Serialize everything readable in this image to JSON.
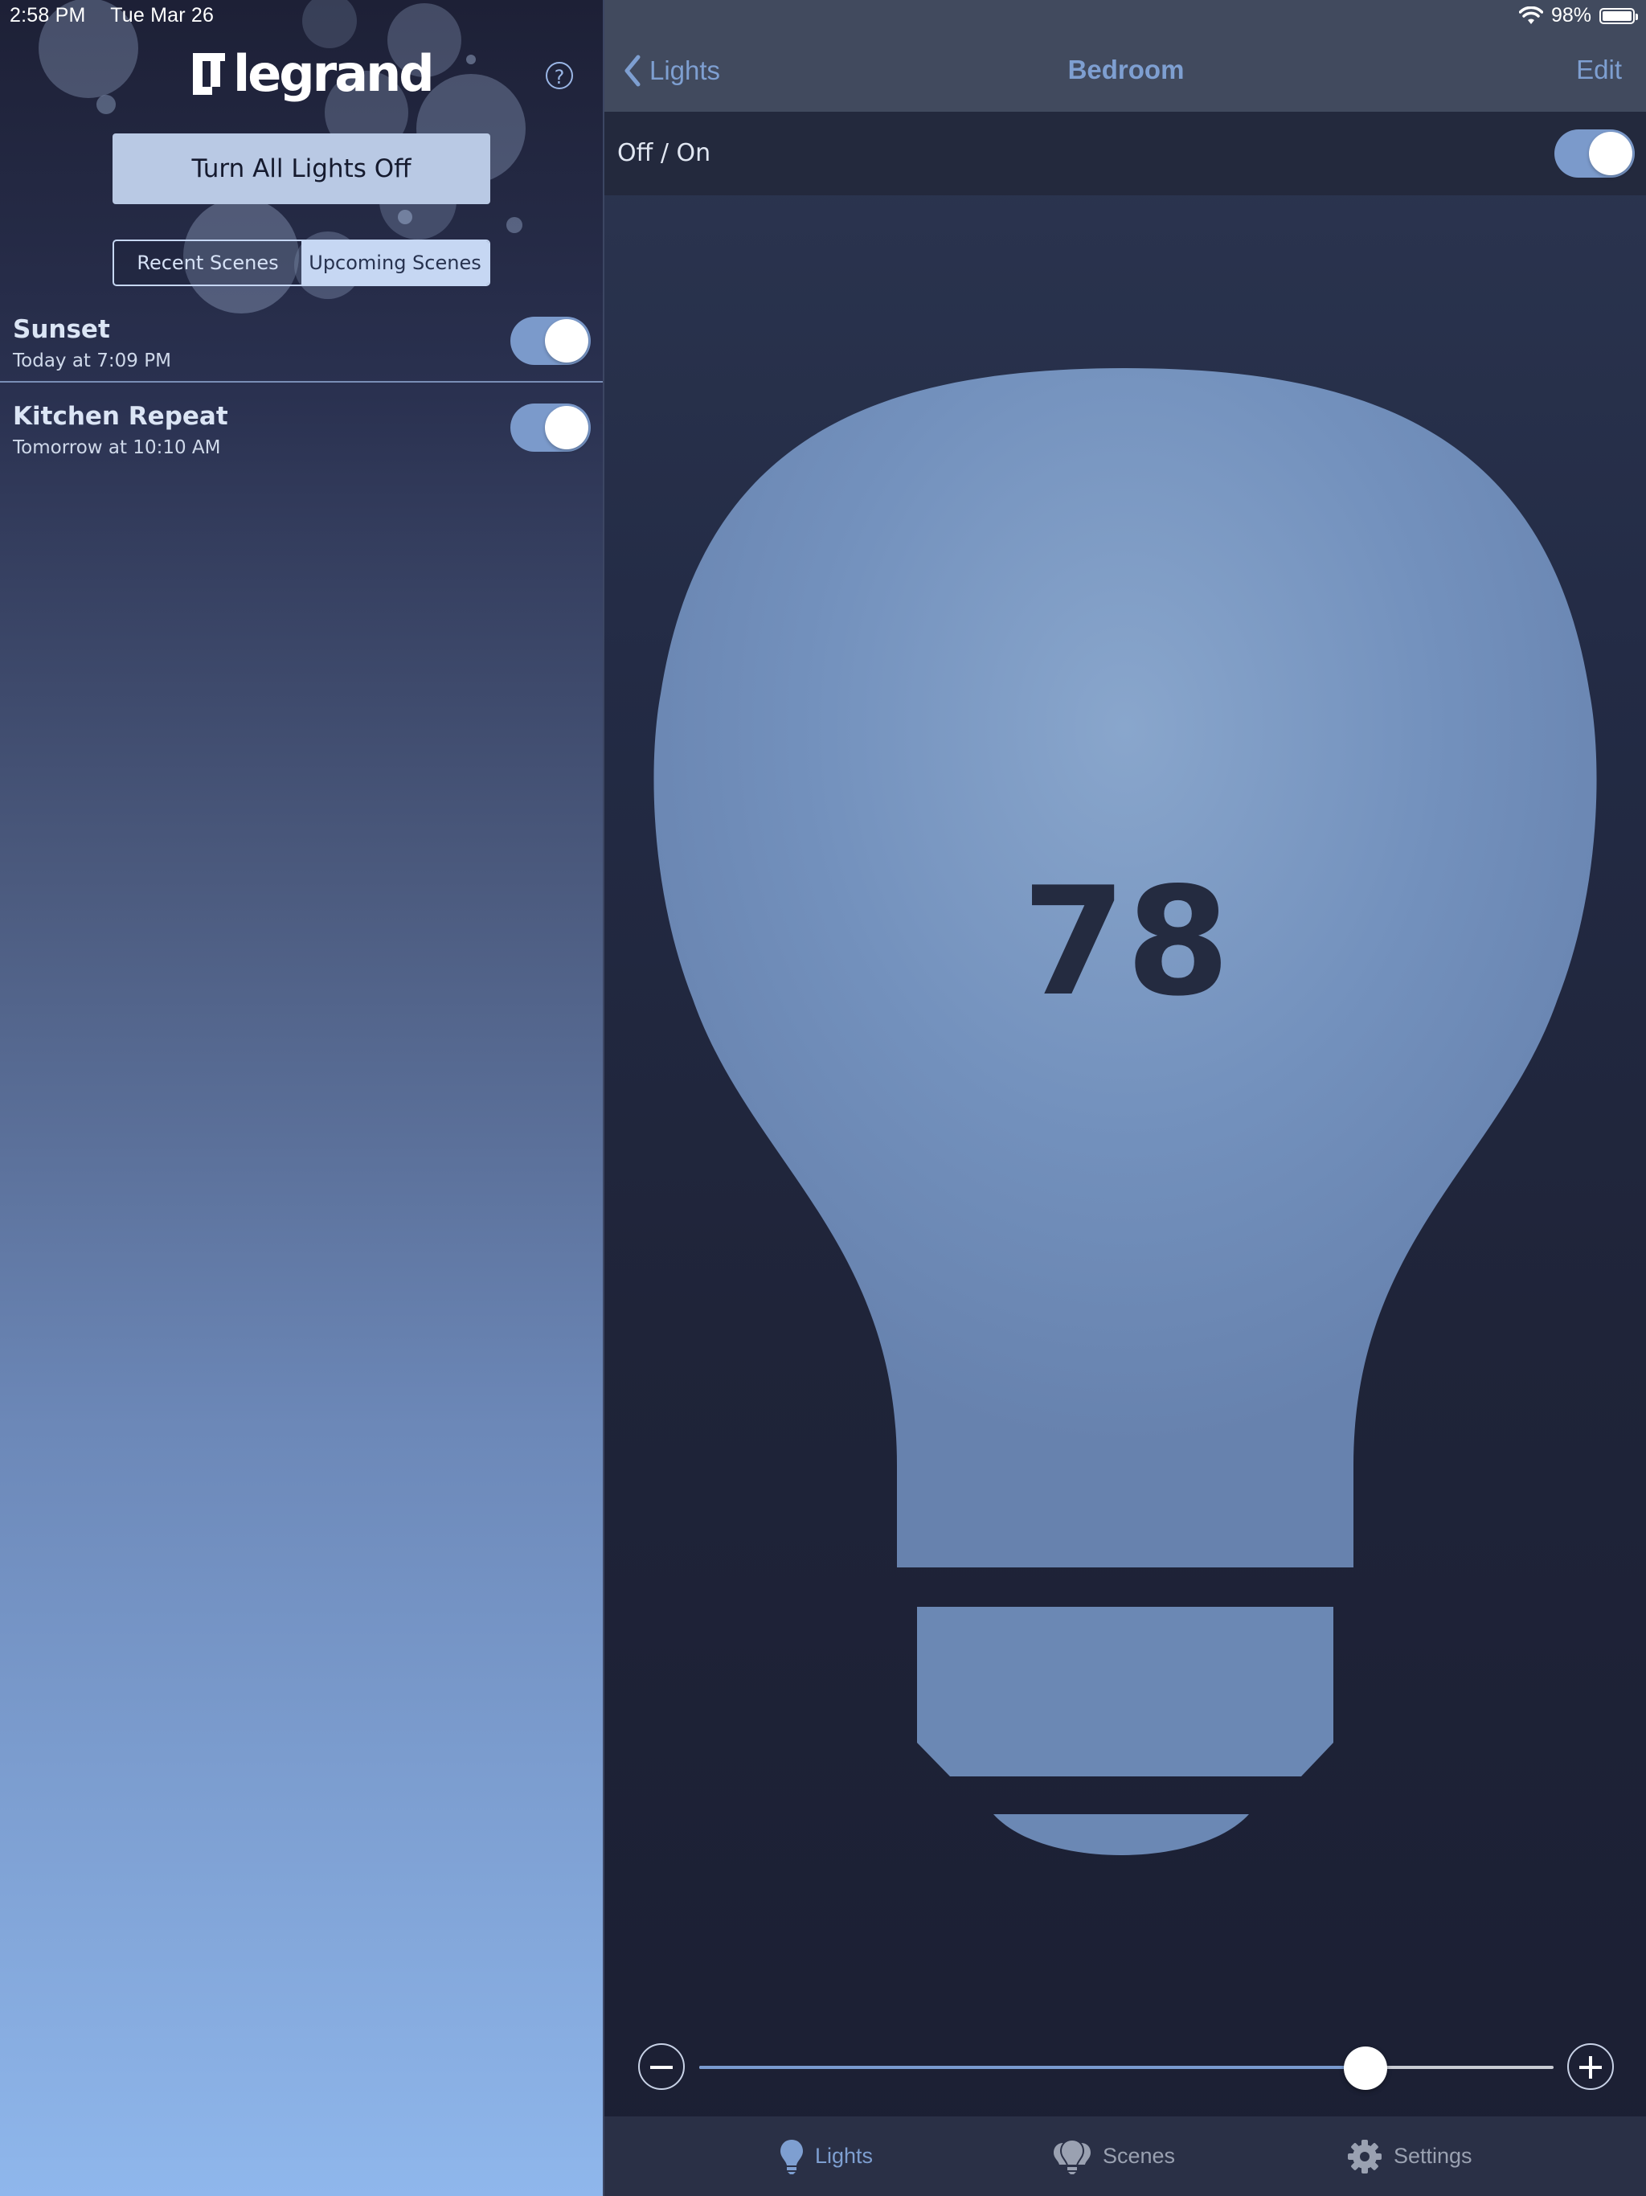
{
  "status_bar": {
    "time": "2:58 PM",
    "date": "Tue Mar 26",
    "battery": "98%"
  },
  "left": {
    "logo_text": "legrand",
    "help_label": "?",
    "all_off_label": "Turn All Lights Off",
    "segments": [
      "Recent Scenes",
      "Upcoming Scenes"
    ],
    "selected_segment": "Upcoming Scenes",
    "scenes": [
      {
        "name": "Sunset",
        "time": "Today at 7:09 PM",
        "enabled": true
      },
      {
        "name": "Kitchen Repeat",
        "time": "Tomorrow at 10:10 AM",
        "enabled": true
      }
    ]
  },
  "right": {
    "back_label": "Lights",
    "title": "Bedroom",
    "edit_label": "Edit",
    "onoff_label": "Off / On",
    "power_on": true,
    "brightness": 78
  },
  "tabs": [
    {
      "label": "Lights",
      "icon": "lightbulb-icon",
      "active": true
    },
    {
      "label": "Scenes",
      "icon": "scenes-bulbs-icon",
      "active": false
    },
    {
      "label": "Settings",
      "icon": "gear-icon",
      "active": false
    }
  ],
  "colors": {
    "accent": "#7e9fd1",
    "bulb": "#6f8db9",
    "toggle_on": "#7b9acb"
  }
}
